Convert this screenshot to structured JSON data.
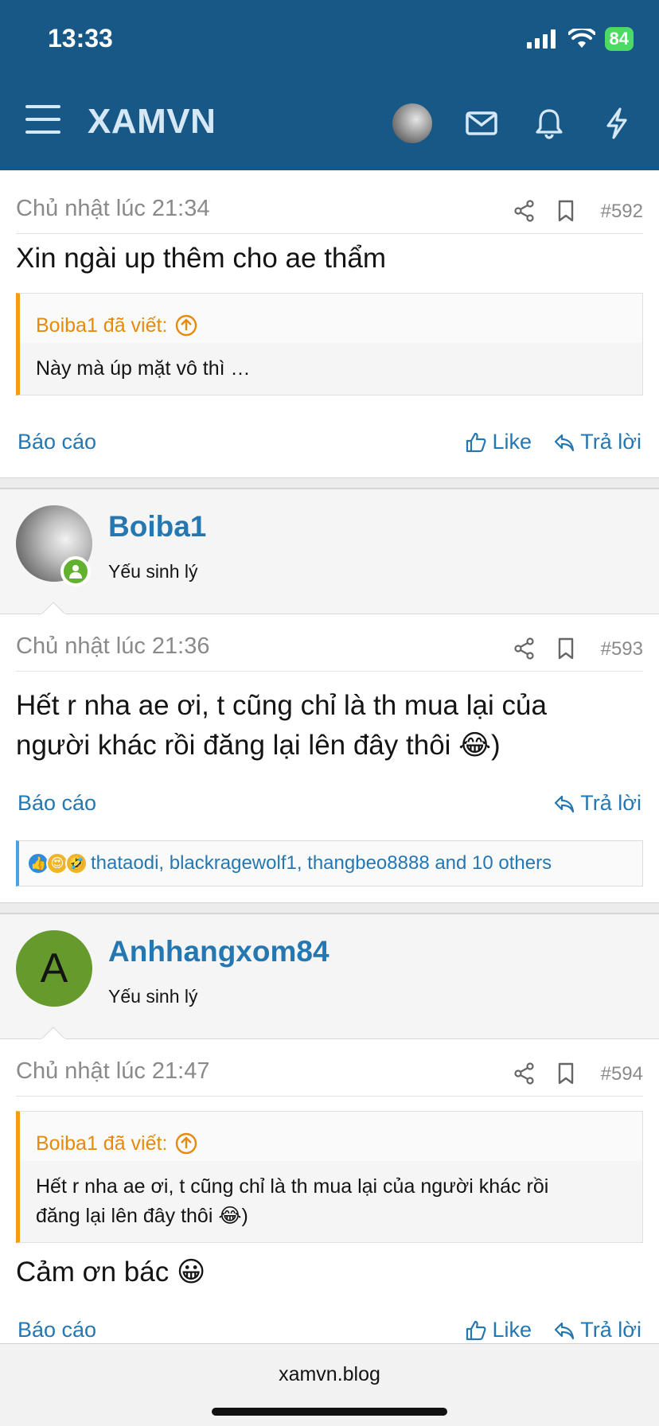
{
  "status": {
    "time": "13:33",
    "battery": "84"
  },
  "header": {
    "brand": "XAMVN"
  },
  "posts": [
    {
      "date": "Chủ nhật lúc 21:34",
      "number": "#592",
      "message": "Xin ngài up thêm cho ae thẩm",
      "quote": {
        "author": "Boiba1 đã viết:",
        "text": "Này mà úp mặt vô thì …"
      },
      "actions": {
        "report": "Báo cáo",
        "like": "Like",
        "reply": "Trả lời"
      }
    },
    {
      "user": {
        "name": "Boiba1",
        "title": "Yếu sinh lý"
      },
      "date": "Chủ nhật lúc 21:36",
      "number": "#593",
      "message_line1": "Hết r nha ae ơi, t cũng chỉ là th mua lại của",
      "message_line2": "người khác rồi đăng lại lên đây thôi 😂)",
      "actions": {
        "report": "Báo cáo",
        "reply": "Trả lời"
      },
      "reactions": "thataodi, blackragewolf1, thangbeo8888 and 10 others"
    },
    {
      "user": {
        "name": "Anhhangxom84",
        "title": "Yếu sinh lý",
        "initial": "A",
        "avatar_color": "#669a2d"
      },
      "date": "Chủ nhật lúc 21:47",
      "number": "#594",
      "quote": {
        "author": "Boiba1 đã viết:",
        "text_line1": "Hết r nha ae ơi, t cũng chỉ là th mua lại của người khác rồi",
        "text_line2": "đăng lại lên đây thôi 😂)"
      },
      "message": "Cảm ơn bác 😀",
      "actions": {
        "report": "Báo cáo",
        "like": "Like",
        "reply": "Trả lời"
      }
    }
  ],
  "browser": {
    "url": "xamvn.blog"
  },
  "colors": {
    "header": "#185886",
    "link": "#2577b1",
    "quote_accent": "#f39c12",
    "online": "#63b22f"
  }
}
